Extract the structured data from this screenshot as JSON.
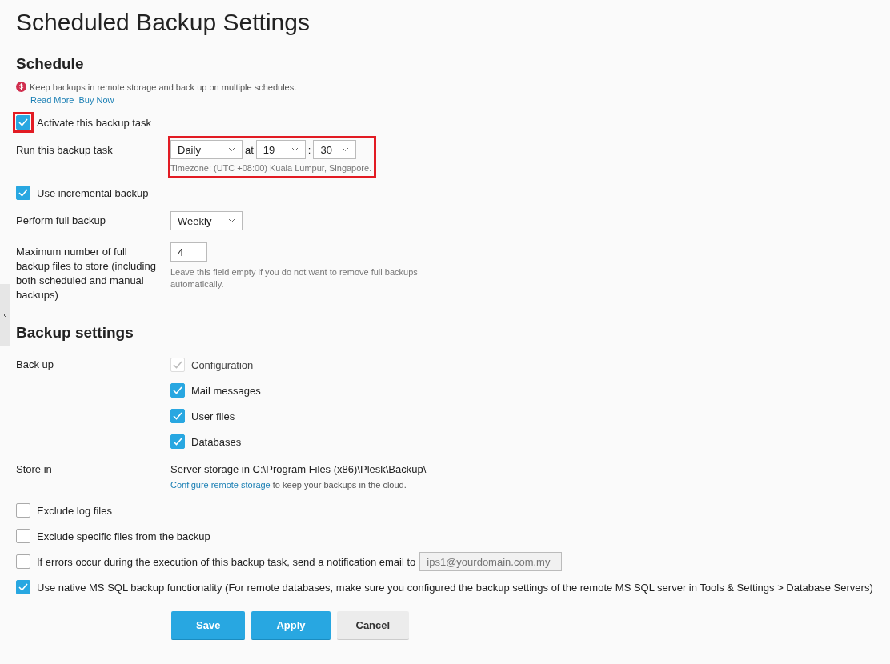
{
  "title": "Scheduled Backup Settings",
  "schedule": {
    "heading": "Schedule",
    "promo": "Keep backups in remote storage and back up on multiple schedules.",
    "links": [
      "Read More",
      "Buy Now"
    ],
    "activate": {
      "label": "Activate this backup task",
      "checked": true,
      "highlighted": true
    },
    "run": {
      "label": "Run this backup task",
      "period": "Daily",
      "connector": "at",
      "hour": "19",
      "separator": ":",
      "minute": "30",
      "timezone": "Timezone: (UTC +08:00) Kuala Lumpur, Singapore.",
      "highlighted": true
    },
    "incremental": {
      "label": "Use incremental backup",
      "checked": true
    },
    "full_backup": {
      "label": "Perform full backup",
      "value": "Weekly"
    },
    "max_files": {
      "label": "Maximum number of full backup files to store (including both scheduled and manual backups)",
      "value": "4",
      "hint": "Leave this field empty if you do not want to remove full backups automatically."
    }
  },
  "backup_settings": {
    "heading": "Backup settings",
    "back_up": {
      "label": "Back up",
      "items": [
        {
          "label": "Configuration",
          "checked": true,
          "disabled": true
        },
        {
          "label": "Mail messages",
          "checked": true,
          "disabled": false
        },
        {
          "label": "User files",
          "checked": true,
          "disabled": false
        },
        {
          "label": "Databases",
          "checked": true,
          "disabled": false
        }
      ]
    },
    "store_in": {
      "label": "Store in",
      "location": "Server storage in C:\\Program Files (x86)\\Plesk\\Backup\\",
      "link": "Configure remote storage",
      "link_suffix": " to keep your backups in the cloud."
    }
  },
  "options": [
    {
      "kind": "checkbox",
      "label": "Exclude log files",
      "checked": false
    },
    {
      "kind": "checkbox",
      "label": "Exclude specific files from the backup",
      "checked": false
    },
    {
      "kind": "email",
      "label": "If errors occur during the execution of this backup task, send a notification email to",
      "checked": false,
      "placeholder": "ips1@yourdomain.com.my",
      "disabled": true
    },
    {
      "kind": "checkbox",
      "label": "Use native MS SQL backup functionality (For remote databases, make sure you configured the backup settings of the remote MS SQL server in Tools & Settings > Database Servers)",
      "checked": true
    }
  ],
  "buttons": [
    {
      "label": "Save",
      "kind": "primary"
    },
    {
      "label": "Apply",
      "kind": "primary"
    },
    {
      "label": "Cancel",
      "kind": "secondary"
    }
  ]
}
